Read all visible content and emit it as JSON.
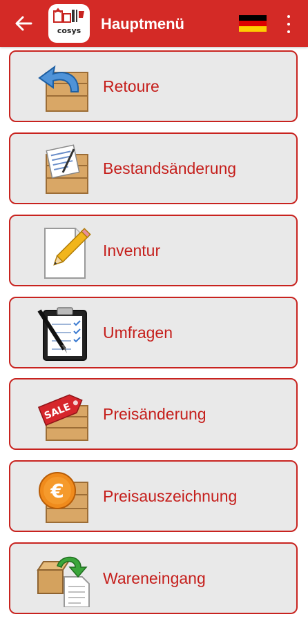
{
  "appbar": {
    "title": "Hauptmenü",
    "back_icon": "arrow-left-icon",
    "logo": "app-logo",
    "language_flag": "germany-flag-icon",
    "more_icon": "more-vert-icon",
    "colors": {
      "bar": "#d42a26",
      "text": "#ffffff"
    }
  },
  "menu": {
    "items": [
      {
        "label": "Retoure",
        "icon": "return-box-icon"
      },
      {
        "label": "Bestandsänderung",
        "icon": "inventory-change-box-icon"
      },
      {
        "label": "Inventur",
        "icon": "document-pencil-icon"
      },
      {
        "label": "Umfragen",
        "icon": "clipboard-survey-icon"
      },
      {
        "label": "Preisänderung",
        "icon": "sale-tag-box-icon"
      },
      {
        "label": "Preisauszeichnung",
        "icon": "euro-coin-box-icon"
      },
      {
        "label": "Wareneingang",
        "icon": "goods-receipt-icon"
      }
    ],
    "colors": {
      "border": "#c8231f",
      "background": "#e9e9e9",
      "text": "#c51f1c"
    }
  }
}
